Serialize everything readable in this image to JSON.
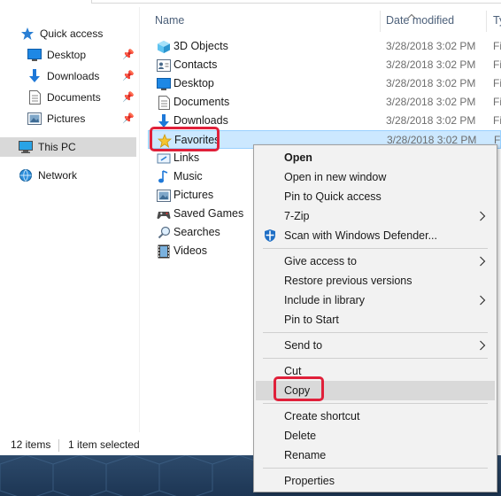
{
  "nav": {
    "items": [
      {
        "label": "Quick access",
        "icon": "star-icon",
        "pinned": false
      },
      {
        "label": "Desktop",
        "icon": "desktop-folder-icon",
        "pinned": true
      },
      {
        "label": "Downloads",
        "icon": "downloads-arrow-icon",
        "pinned": true
      },
      {
        "label": "Documents",
        "icon": "document-icon",
        "pinned": true
      },
      {
        "label": "Pictures",
        "icon": "pictures-icon",
        "pinned": true
      },
      {
        "label": "This PC",
        "icon": "computer-icon",
        "selected": true
      },
      {
        "label": "Network",
        "icon": "network-icon"
      }
    ]
  },
  "columns": {
    "name": "Name",
    "date_modified": "Date modified",
    "type": "Ty"
  },
  "files": [
    {
      "name": "3D Objects",
      "date": "3/28/2018 3:02 PM",
      "type": "Fi",
      "icon": "3d-objects-icon"
    },
    {
      "name": "Contacts",
      "date": "3/28/2018 3:02 PM",
      "type": "Fi",
      "icon": "contacts-icon"
    },
    {
      "name": "Desktop",
      "date": "3/28/2018 3:02 PM",
      "type": "Fi",
      "icon": "desktop-folder-icon"
    },
    {
      "name": "Documents",
      "date": "3/28/2018 3:02 PM",
      "type": "Fi",
      "icon": "document-icon"
    },
    {
      "name": "Downloads",
      "date": "3/28/2018 3:02 PM",
      "type": "Fi",
      "icon": "downloads-arrow-icon"
    },
    {
      "name": "Favorites",
      "date": "3/28/2018 3:02 PM",
      "type": "Fi",
      "icon": "favorites-star-icon",
      "selected": true
    },
    {
      "name": "Links",
      "date": "",
      "type": "",
      "icon": "links-icon"
    },
    {
      "name": "Music",
      "date": "",
      "type": "",
      "icon": "music-note-icon"
    },
    {
      "name": "Pictures",
      "date": "",
      "type": "",
      "icon": "pictures-icon"
    },
    {
      "name": "Saved Games",
      "date": "",
      "type": "",
      "icon": "saved-games-icon"
    },
    {
      "name": "Searches",
      "date": "",
      "type": "",
      "icon": "search-icon"
    },
    {
      "name": "Videos",
      "date": "",
      "type": "",
      "icon": "videos-icon"
    }
  ],
  "status": {
    "item_count": "12 items",
    "selection": "1 item selected"
  },
  "context_menu": {
    "open": "Open",
    "open_new_window": "Open in new window",
    "pin_quick_access": "Pin to Quick access",
    "seven_zip": "7-Zip",
    "scan_defender": "Scan with Windows Defender...",
    "give_access": "Give access to",
    "restore_versions": "Restore previous versions",
    "include_library": "Include in library",
    "pin_start": "Pin to Start",
    "send_to": "Send to",
    "cut": "Cut",
    "copy": "Copy",
    "create_shortcut": "Create shortcut",
    "delete": "Delete",
    "rename": "Rename",
    "properties": "Properties"
  },
  "colors": {
    "selection_bg": "#cce8ff",
    "selection_border": "#99d1ff",
    "highlight_red": "#e0203a",
    "menu_bg": "#f2f2f2",
    "header_text": "#4c607a"
  }
}
